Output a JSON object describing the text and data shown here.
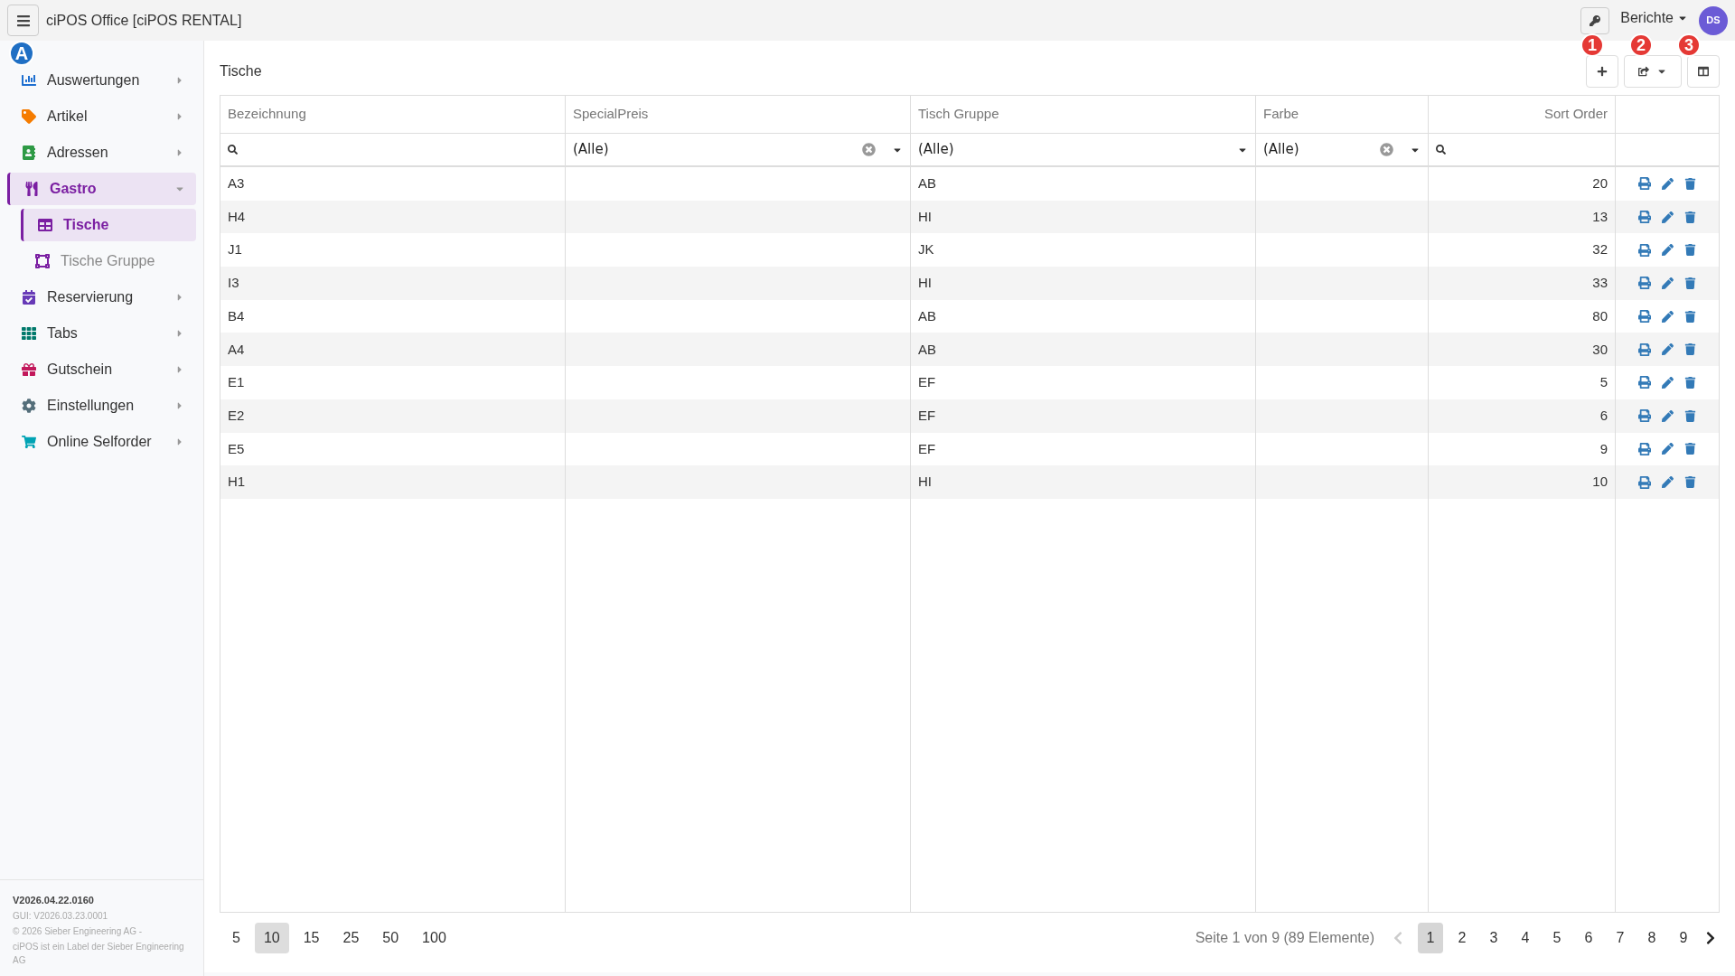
{
  "window": {
    "title": "ciPOS Office [ciPOS RENTAL]"
  },
  "topbar": {
    "reports_menu": "Berichte",
    "avatar": "DS"
  },
  "sidebar": {
    "items": [
      {
        "label": "Auswertungen",
        "expanded": false,
        "selected": false
      },
      {
        "label": "Artikel",
        "expanded": false,
        "selected": false
      },
      {
        "label": "Adressen",
        "expanded": false,
        "selected": false
      },
      {
        "label": "Gastro",
        "expanded": true,
        "selected": true,
        "children": [
          {
            "label": "Tische",
            "selected": true
          },
          {
            "label": "Tische Gruppe",
            "selected": false
          }
        ]
      },
      {
        "label": "Reservierung",
        "expanded": false,
        "selected": false
      },
      {
        "label": "Tabs",
        "expanded": false,
        "selected": false
      },
      {
        "label": "Gutschein",
        "expanded": false,
        "selected": false
      },
      {
        "label": "Einstellungen",
        "expanded": false,
        "selected": false
      },
      {
        "label": "Online Selforder",
        "expanded": false,
        "selected": false
      }
    ],
    "footer": {
      "version": "V2026.04.22.0160",
      "gui": "GUI: V2026.03.23.0001",
      "copyright": "© 2026 Sieber Engineering AG -",
      "label": "ciPOS ist ein Label der Sieber Engineering AG"
    }
  },
  "page": {
    "title": "Tische"
  },
  "annotations": [
    {
      "text": "A"
    },
    {
      "text": "1"
    },
    {
      "text": "2"
    },
    {
      "text": "3"
    }
  ],
  "table": {
    "columns": [
      {
        "label": "Bezeichnung",
        "kind": "search"
      },
      {
        "label": "SpecialPreis",
        "kind": "select",
        "value": "(Alle)",
        "clearable": true
      },
      {
        "label": "Tisch Gruppe",
        "kind": "select",
        "value": "(Alle)",
        "clearable": false
      },
      {
        "label": "Farbe",
        "kind": "select",
        "value": "(Alle)",
        "clearable": true
      },
      {
        "label": "Sort Order",
        "kind": "search"
      }
    ],
    "rows": [
      [
        "A3",
        "",
        "AB",
        "",
        "20"
      ],
      [
        "H4",
        "",
        "HI",
        "",
        "13"
      ],
      [
        "J1",
        "",
        "JK",
        "",
        "32"
      ],
      [
        "I3",
        "",
        "HI",
        "",
        "33"
      ],
      [
        "B4",
        "",
        "AB",
        "",
        "80"
      ],
      [
        "A4",
        "",
        "AB",
        "",
        "30"
      ],
      [
        "E1",
        "",
        "EF",
        "",
        "5"
      ],
      [
        "E2",
        "",
        "EF",
        "",
        "6"
      ],
      [
        "E5",
        "",
        "EF",
        "",
        "9"
      ],
      [
        "H1",
        "",
        "HI",
        "",
        "10"
      ]
    ]
  },
  "pager": {
    "sizes": [
      {
        "label": "5",
        "selected": false
      },
      {
        "label": "10",
        "selected": true
      },
      {
        "label": "15",
        "selected": false
      },
      {
        "label": "25",
        "selected": false
      },
      {
        "label": "50",
        "selected": false
      },
      {
        "label": "100",
        "selected": false
      }
    ],
    "info": "Seite 1 von 9 (89 Elemente)",
    "pages": [
      {
        "label": "1",
        "selected": true
      },
      {
        "label": "2",
        "selected": false
      },
      {
        "label": "3",
        "selected": false
      },
      {
        "label": "4",
        "selected": false
      },
      {
        "label": "5",
        "selected": false
      },
      {
        "label": "6",
        "selected": false
      },
      {
        "label": "7",
        "selected": false
      },
      {
        "label": "8",
        "selected": false
      },
      {
        "label": "9",
        "selected": false
      }
    ],
    "prev_disabled": true,
    "next_disabled": false
  }
}
